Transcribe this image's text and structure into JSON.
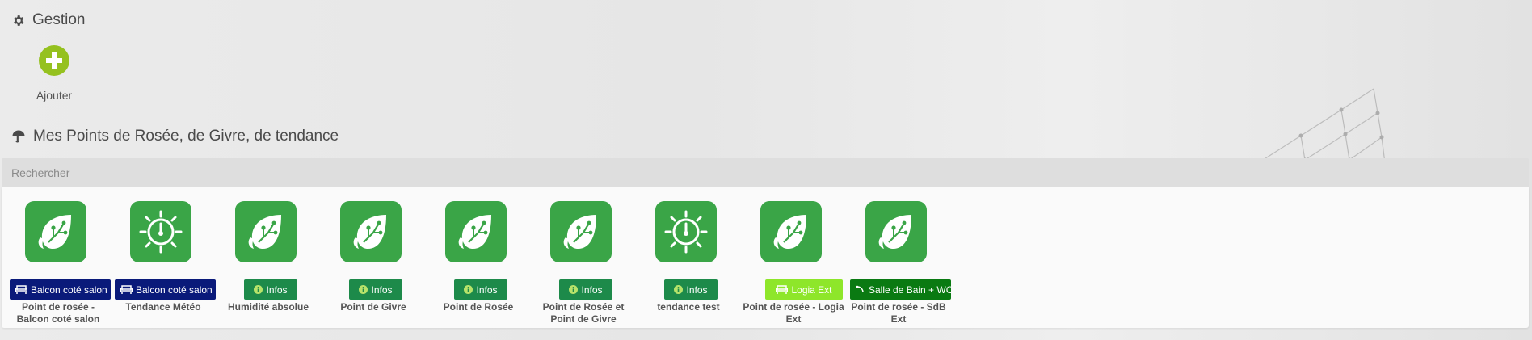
{
  "gestion": {
    "title": "Gestion",
    "icon": "gear-icon",
    "add_label": "Ajouter",
    "add_icon": "plus-circle-icon",
    "accent": "#95c11f"
  },
  "points": {
    "title": "Mes Points de Rosée, de Givre, de tendance",
    "icon": "umbrella-icon"
  },
  "search": {
    "placeholder": "Rechercher"
  },
  "equipments": [
    {
      "name": "Point de rosée - Balcon coté salon",
      "icon": "leaf-circuit-icon",
      "badge": "Balcon coté salon",
      "badge_icon": "sofa-icon",
      "badge_color": "#0a1a7a"
    },
    {
      "name": "Tendance Météo",
      "icon": "compass-dial-icon",
      "badge": "Balcon coté salon",
      "badge_icon": "sofa-icon",
      "badge_color": "#0a1a7a"
    },
    {
      "name": "Humidité absolue",
      "icon": "leaf-circuit-icon",
      "badge": "Infos",
      "badge_icon": "info-icon",
      "badge_color": "#1d8a4a"
    },
    {
      "name": "Point de Givre",
      "icon": "leaf-circuit-icon",
      "badge": "Infos",
      "badge_icon": "info-icon",
      "badge_color": "#1d8a4a"
    },
    {
      "name": "Point de Rosée",
      "icon": "leaf-circuit-icon",
      "badge": "Infos",
      "badge_icon": "info-icon",
      "badge_color": "#1d8a4a"
    },
    {
      "name": "Point de Rosée et Point de Givre",
      "icon": "leaf-circuit-icon",
      "badge": "Infos",
      "badge_icon": "info-icon",
      "badge_color": "#1d8a4a"
    },
    {
      "name": "tendance test",
      "icon": "compass-dial-icon",
      "badge": "Infos",
      "badge_icon": "info-icon",
      "badge_color": "#1d8a4a"
    },
    {
      "name": "Point de rosée - Logia Ext",
      "icon": "leaf-circuit-icon",
      "badge": "Logia Ext",
      "badge_icon": "sofa-icon",
      "badge_color": "#8ee62a"
    },
    {
      "name": "Point de rosée - SdB Ext",
      "icon": "leaf-circuit-icon",
      "badge": "Salle de Bain + WC",
      "badge_icon": "shower-icon",
      "badge_color": "#0a7a12"
    }
  ]
}
